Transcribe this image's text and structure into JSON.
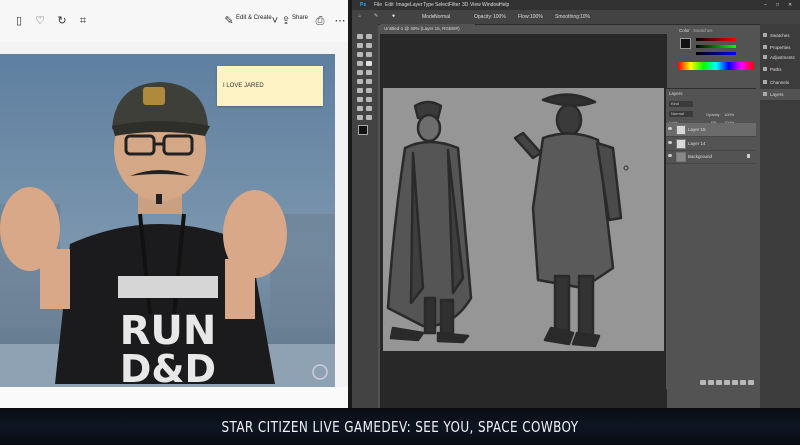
{
  "photos": {
    "toolbar": {
      "edit_create_label": "Edit & Create",
      "share_label": "Share",
      "icons": [
        "delete-icon",
        "heart-icon",
        "rotate-icon",
        "crop-icon",
        "edit-icon",
        "share-icon",
        "print-icon",
        "more-icon"
      ]
    },
    "sticky_note": {
      "text": "I LOVE JARED"
    },
    "shirt_text": {
      "line1": "RUN",
      "line2": "D&D"
    }
  },
  "photoshop": {
    "menu": [
      "Ps",
      "File",
      "Edit",
      "Image",
      "Layer",
      "Type",
      "Select",
      "Filter",
      "3D",
      "View",
      "Window",
      "Help"
    ],
    "options": {
      "mode_label": "Mode:",
      "mode_value": "Normal",
      "opacity_label": "Opacity:",
      "opacity_value": "100%",
      "flow_label": "Flow:",
      "flow_value": "100%",
      "smoothing_label": "Smoothing:",
      "smoothing_value": "10%"
    },
    "document_tab": "Untitled-1 @ 40% (Layer 15, RGB/8#)",
    "color_panel": {
      "tab_color": "Color",
      "tab_swatches": "Swatches"
    },
    "layers_panel": {
      "title": "Layers",
      "kind_label": "Kind",
      "blend_value": "Normal",
      "opacity_label": "Opacity:",
      "opacity_value": "100%",
      "lock_label": "Lock:",
      "fill_label": "Fill:",
      "fill_value": "100%",
      "layers": [
        {
          "name": "Layer 15"
        },
        {
          "name": "Layer 14"
        },
        {
          "name": "Background"
        }
      ]
    },
    "dock": [
      "Swatches",
      "Properties",
      "Adjustments",
      "Paths",
      "Channels",
      "Layers"
    ]
  },
  "caption": {
    "text": "STAR CITIZEN LIVE GAMEDEV: SEE YOU, SPACE COWBOY"
  }
}
